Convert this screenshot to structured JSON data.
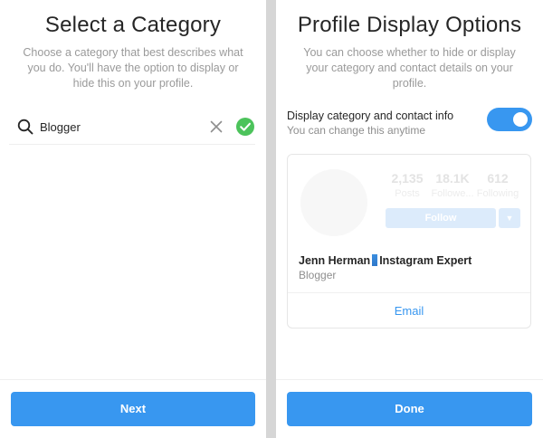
{
  "left": {
    "title": "Select a Category",
    "subtitle": "Choose a category that best describes what you do. You'll have the option to display or hide this on your profile.",
    "search_value": "Blogger",
    "next_label": "Next"
  },
  "right": {
    "title": "Profile Display Options",
    "subtitle": "You can choose whether to hide or display your category and contact details on your profile.",
    "toggle_label": "Display category and contact info",
    "toggle_sub": "You can change this anytime",
    "toggle_on": true,
    "preview": {
      "posts_count": "2,135",
      "posts_label": "Posts",
      "followers_count": "18.1K",
      "followers_label": "Followe...",
      "following_count": "612",
      "following_label": "Following",
      "follow_label": "Follow",
      "name_part1": "Jenn Herman",
      "name_part2": "Instagram Expert",
      "category": "Blogger",
      "email_label": "Email"
    },
    "done_label": "Done"
  },
  "colors": {
    "accent": "#3897f0",
    "success": "#4cc35b",
    "divider": "#d6d6d6"
  },
  "icons": {
    "search": "search-icon",
    "clear": "close-icon",
    "check": "check-circle-icon",
    "dropdown": "chevron-down-icon",
    "name_emoji": "blue-book-icon"
  }
}
